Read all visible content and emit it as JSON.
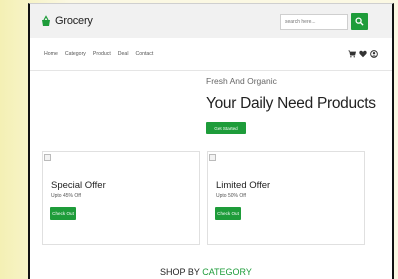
{
  "header": {
    "logo_text": "Grocery",
    "search_placeholder": "search here...",
    "search_icon": "search-icon"
  },
  "nav": {
    "links": [
      "Home",
      "Category",
      "Product",
      "Deal",
      "Contact"
    ],
    "icons": [
      "cart-icon",
      "heart-icon",
      "user-icon"
    ]
  },
  "hero": {
    "subtitle": "Fresh And Organic",
    "title": "Your Daily Need Products",
    "cta_label": "Get Started"
  },
  "offers": [
    {
      "title": "Special Offer",
      "subtitle": "Upto 45% Off",
      "button_label": "Check Out"
    },
    {
      "title": "Limited Offer",
      "subtitle": "Upto 50% Off",
      "button_label": "Check Out"
    }
  ],
  "section": {
    "heading_prefix": "SHOP BY",
    "heading_accent": "CATEGORY"
  },
  "colors": {
    "brand_green": "#1e9c3a",
    "topbar_bg": "#f1f1f1",
    "page_bg": "#fbf8e3"
  }
}
